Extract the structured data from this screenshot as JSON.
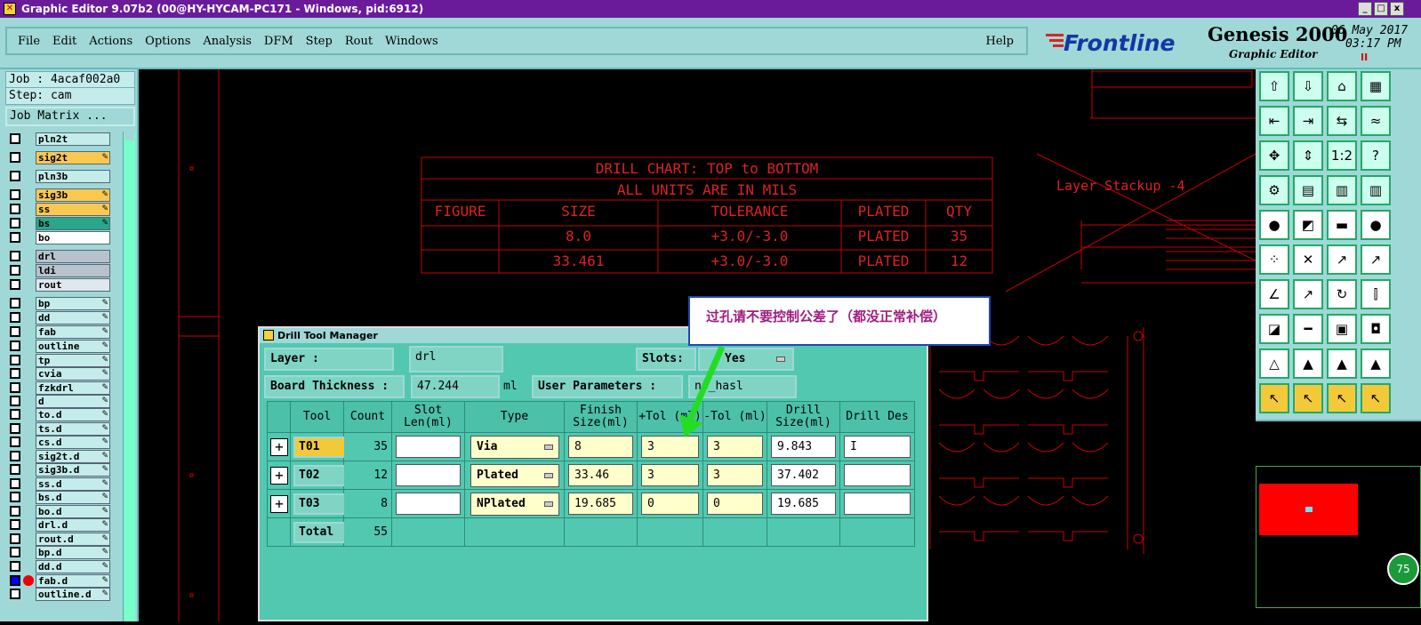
{
  "window": {
    "title": "Graphic Editor 9.07b2 (00@HY-HYCAM-PC171 - Windows, pid:6912)"
  },
  "menu": [
    "File",
    "Edit",
    "Actions",
    "Options",
    "Analysis",
    "DFM",
    "Step",
    "Rout",
    "Windows"
  ],
  "help": "Help",
  "brand": {
    "logo": "Frontline",
    "product": "Genesis 2000",
    "subtitle": "Graphic Editor",
    "date": "06 May 2017",
    "time": "03:17 PM"
  },
  "job": {
    "job_label": "Job : 4acaf002a0",
    "step_label": "Step: cam",
    "matrix_button": "Job Matrix ..."
  },
  "layers": [
    {
      "name": "pln2t",
      "color": "#c4ecea"
    },
    {
      "name": "sig2t",
      "color": "#f8c850"
    },
    {
      "name": "pln3b",
      "color": "#c4ecea"
    },
    {
      "name": "sig3b",
      "color": "#f8c850"
    },
    {
      "name": "ss",
      "color": "#f8c850"
    },
    {
      "name": "bs",
      "color": "#2aa68a"
    },
    {
      "name": "bo",
      "color": "#ffffff"
    },
    {
      "name": "drl",
      "color": "#b8c2cc"
    },
    {
      "name": "ldi",
      "color": "#b8c2cc"
    },
    {
      "name": "rout",
      "color": "#dfe7ee"
    },
    {
      "name": "bp",
      "color": "#c4ecea"
    },
    {
      "name": "dd",
      "color": "#c4ecea"
    },
    {
      "name": "fab",
      "color": "#c4ecea"
    },
    {
      "name": "outline",
      "color": "#c4ecea"
    },
    {
      "name": "tp",
      "color": "#c4ecea"
    },
    {
      "name": "cvia",
      "color": "#c4ecea"
    },
    {
      "name": "fzkdrl",
      "color": "#c4ecea"
    },
    {
      "name": "d",
      "color": "#c4ecea"
    },
    {
      "name": "to.d",
      "color": "#c4ecea"
    },
    {
      "name": "ts.d",
      "color": "#c4ecea"
    },
    {
      "name": "cs.d",
      "color": "#c4ecea"
    },
    {
      "name": "sig2t.d",
      "color": "#c4ecea"
    },
    {
      "name": "sig3b.d",
      "color": "#c4ecea"
    },
    {
      "name": "ss.d",
      "color": "#c4ecea"
    },
    {
      "name": "bs.d",
      "color": "#c4ecea"
    },
    {
      "name": "bo.d",
      "color": "#c4ecea"
    },
    {
      "name": "drl.d",
      "color": "#c4ecea"
    },
    {
      "name": "rout.d",
      "color": "#c4ecea"
    },
    {
      "name": "bp.d",
      "color": "#c4ecea"
    },
    {
      "name": "dd.d",
      "color": "#c4ecea"
    },
    {
      "name": "fab.d",
      "color": "#c4ecea"
    },
    {
      "name": "outline.d",
      "color": "#c4ecea"
    }
  ],
  "drill_chart": {
    "title": "DRILL CHART: TOP to BOTTOM",
    "subtitle": "ALL UNITS ARE IN MILS",
    "headers": [
      "FIGURE",
      "SIZE",
      "TOLERANCE",
      "PLATED",
      "QTY"
    ],
    "rows": [
      [
        "",
        "8.0",
        "+3.0/-3.0",
        "PLATED",
        "35"
      ],
      [
        "",
        "33.461",
        "+3.0/-3.0",
        "PLATED",
        "12"
      ]
    ]
  },
  "stackup_label": "Layer Stackup -4",
  "dialog": {
    "title": "Drill Tool Manager",
    "layer_label": "Layer          :",
    "layer_value": "drl",
    "slots_label": "Slots:",
    "slots_value": "Yes",
    "thickness_label": "Board Thickness :",
    "thickness_value": "47.244",
    "thickness_unit": "ml",
    "user_params_label": "User Parameters :",
    "user_params_value": "no_hasl",
    "columns": [
      "Tool",
      "Count",
      "Slot Len(ml)",
      "Type",
      "Finish Size(ml)",
      "+Tol (ml)",
      "-Tol (ml)",
      "Drill Size(ml)",
      "Drill Des"
    ],
    "rows": [
      {
        "tool": "T01",
        "count": "35",
        "slot": "",
        "type": "Via",
        "finish": "8",
        "ptol": "3",
        "ntol": "3",
        "drill": "9.843",
        "des": "I"
      },
      {
        "tool": "T02",
        "count": "12",
        "slot": "",
        "type": "Plated",
        "finish": "33.46",
        "ptol": "3",
        "ntol": "3",
        "drill": "37.402",
        "des": ""
      },
      {
        "tool": "T03",
        "count": "8",
        "slot": "",
        "type": "NPlated",
        "finish": "19.685",
        "ptol": "0",
        "ntol": "0",
        "drill": "19.685",
        "des": ""
      }
    ],
    "total_label": "Total",
    "total_count": "55"
  },
  "callout": "过孔请不要控制公差了（都没正常补偿）",
  "zoom_badge": "75"
}
